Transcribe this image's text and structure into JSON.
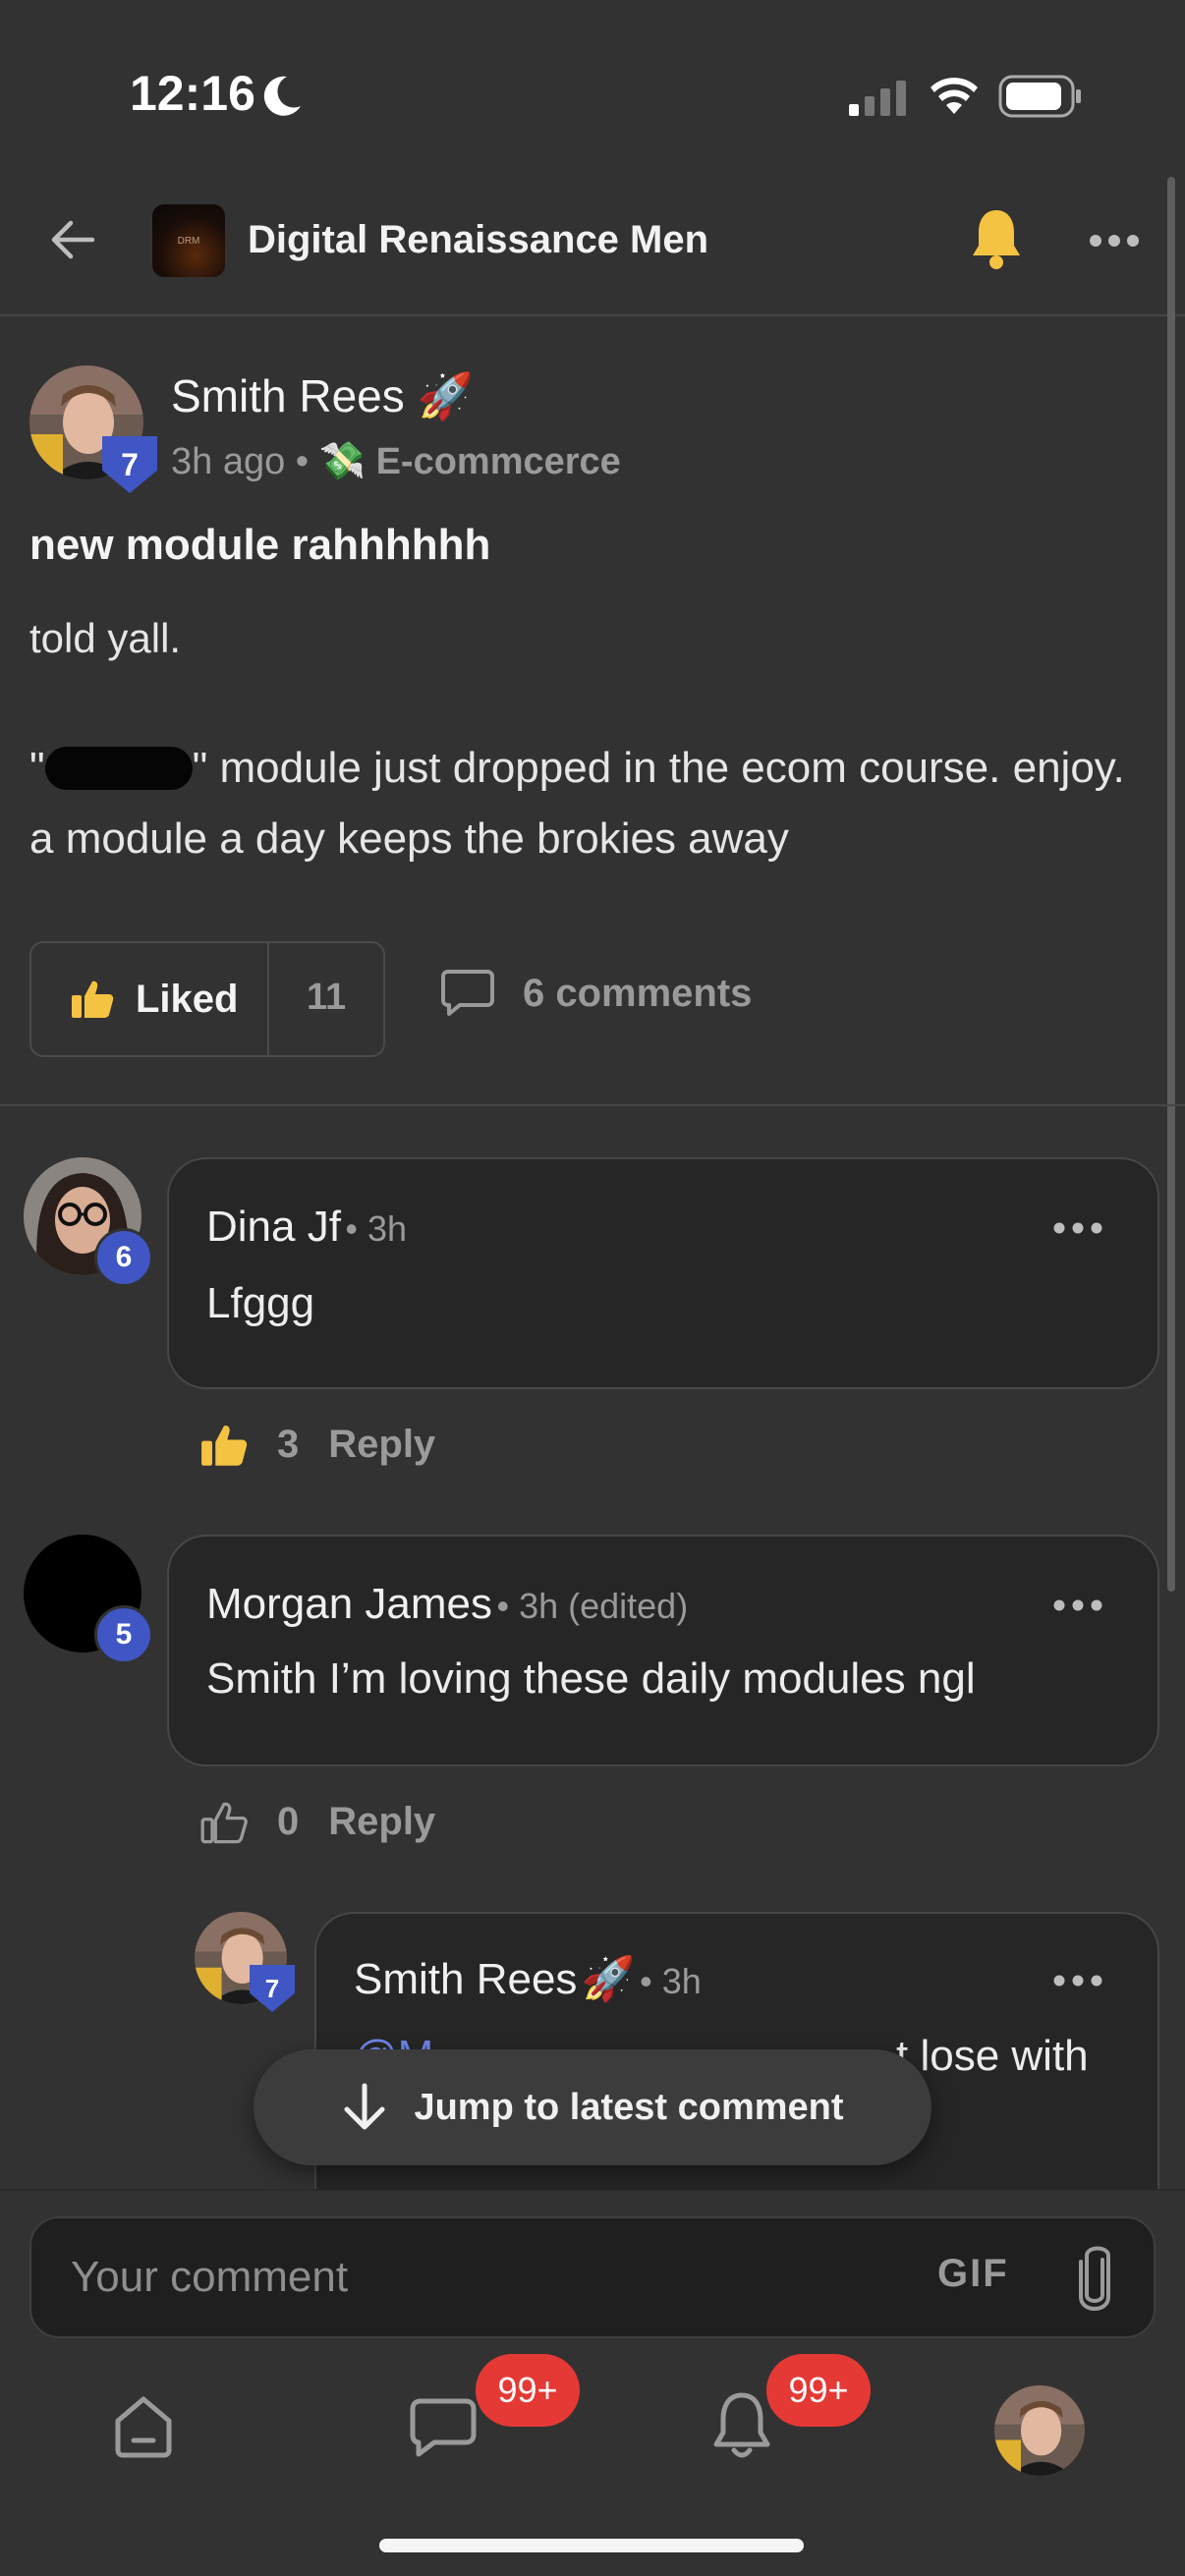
{
  "status_bar": {
    "time": "12:16"
  },
  "header": {
    "group_title": "Digital Renaissance Men",
    "logo_text": "DRM"
  },
  "post": {
    "author": "Smith Rees",
    "author_emoji": "🚀",
    "level": "7",
    "time": "3h ago",
    "category_emoji": "💸",
    "category": "E-commcerce",
    "title": "new module rahhhhhh",
    "line1": "told yall.",
    "body_quote_open": "\"",
    "body_quote_close": "\"",
    "body_rest": " module just dropped in the ecom course. enjoy. a module a day keeps the brokies away",
    "liked_label": "Liked",
    "like_count": "11",
    "comments_label": "6 comments"
  },
  "comments": [
    {
      "name": "Dina Jf",
      "meta": "3h",
      "level": "6",
      "text": "Lfggg",
      "likes": "3",
      "reply_label": "Reply",
      "liked": true
    },
    {
      "name": "Morgan James",
      "meta": "3h (edited)",
      "level": "5",
      "text": "Smith I’m loving these daily modules ngl",
      "likes": "0",
      "reply_label": "Reply",
      "liked": false
    },
    {
      "name": "Smith Rees",
      "emoji": "🚀",
      "meta": "3h",
      "level": "7",
      "text_partial": "t lose with",
      "mention_partial": "@M"
    }
  ],
  "jump_label": "Jump to latest comment",
  "composer": {
    "placeholder": "Your comment",
    "gif_label": "GIF"
  },
  "bottom_nav": {
    "chat_badge": "99+",
    "notif_badge": "99+"
  },
  "colors": {
    "accent_blue": "#3f56c4",
    "like_yellow": "#f5c342",
    "badge_red": "#e53935",
    "background": "#323232"
  }
}
